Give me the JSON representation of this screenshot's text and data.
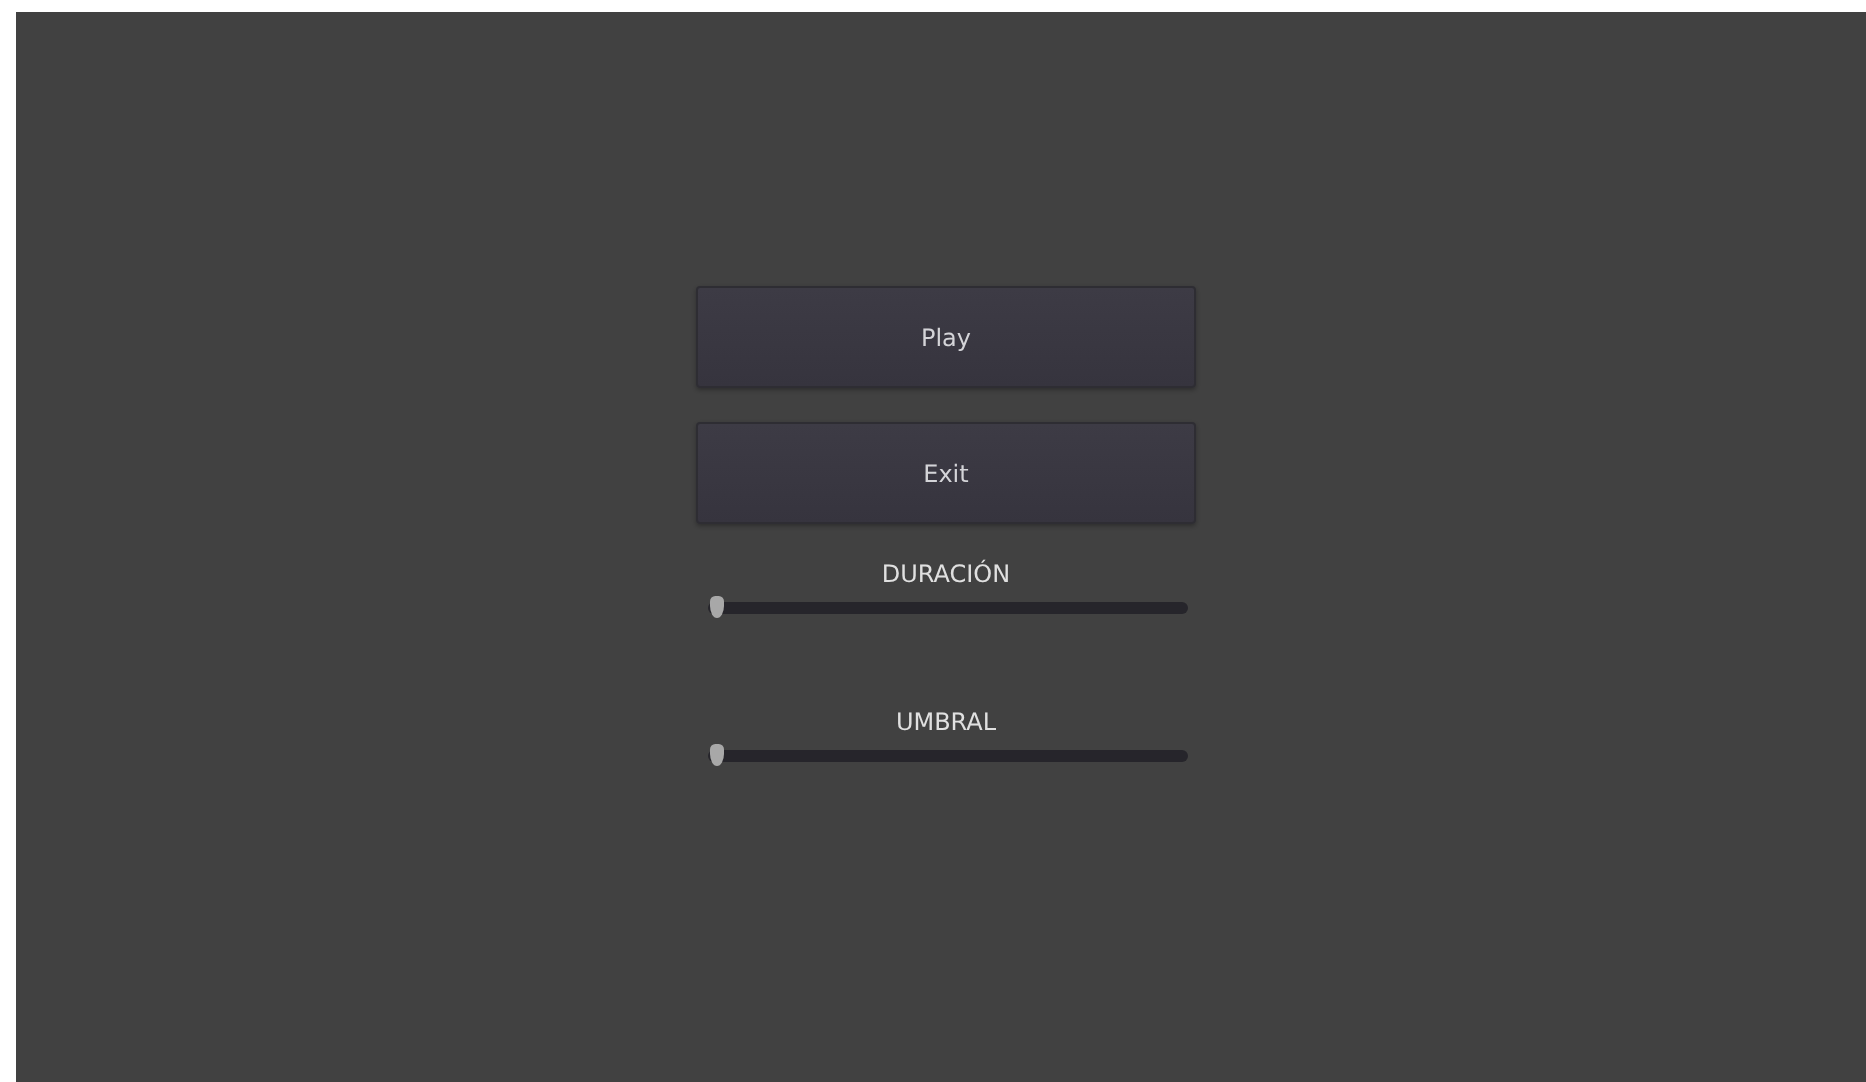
{
  "buttons": [
    {
      "label": "Play"
    },
    {
      "label": "Exit"
    }
  ],
  "sliders": [
    {
      "label": "DURACIÓN",
      "level": 0
    },
    {
      "label": "UMBRAL",
      "level": 0
    }
  ]
}
